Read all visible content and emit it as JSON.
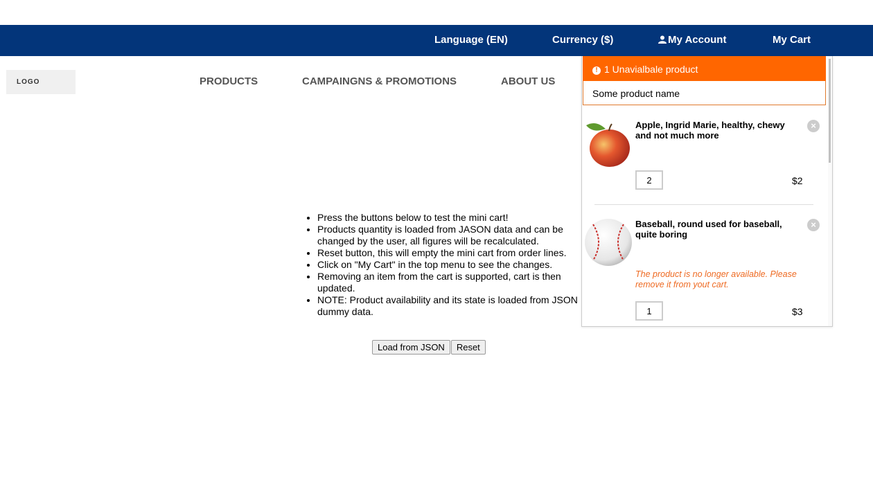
{
  "topnav": {
    "language": "Language (EN)",
    "currency": "Currency ($)",
    "account": "My Account",
    "cart": "My Cart"
  },
  "logo": "LOGO",
  "mainnav": [
    "PRODUCTS",
    "CAMPAINGNS & PROMOTIONS",
    "ABOUT US"
  ],
  "info": [
    "Press the buttons below to test the mini cart!",
    "Products quantity is loaded from JASON data and can be changed by the user, all figures will be recalculated.",
    "Reset button, this will empty the mini cart from order lines.",
    "Click on \"My Cart\" in the top menu to see the changes.",
    "Removing an item from the cart is supported, cart is then updated.",
    "NOTE: Product availability and its state is loaded from JSON dummy data."
  ],
  "buttons": {
    "load": "Load from JSON",
    "reset": "Reset"
  },
  "minicart": {
    "alert_title": "1 Unavialbale product",
    "alert_product": "Some product name",
    "items": [
      {
        "name": "Apple, Ingrid Marie, healthy, chewy and not much more",
        "qty": "2",
        "price": "$2",
        "image": "apple-image"
      },
      {
        "name": "Baseball, round used for baseball, quite boring",
        "warning": "The product is no longer available. Please remove it from yout cart.",
        "qty": "1",
        "price": "$3",
        "image": "baseball-image"
      }
    ]
  },
  "colors": {
    "topbar": "#03357a",
    "alert": "#ff6600",
    "warning": "#ee6a22"
  }
}
